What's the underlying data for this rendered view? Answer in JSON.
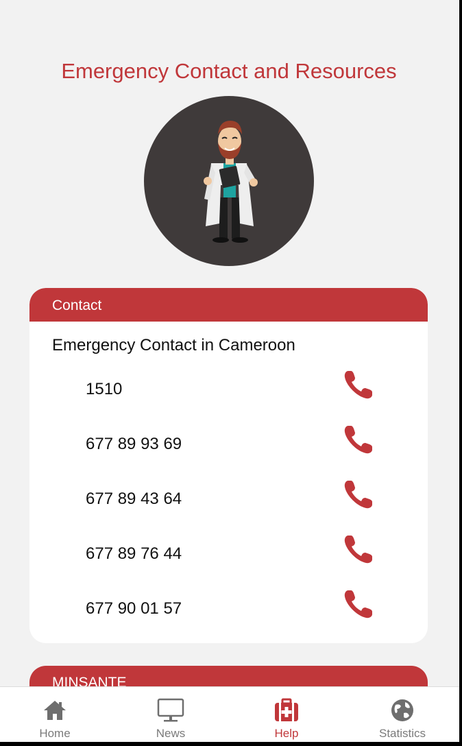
{
  "page": {
    "title": "Emergency Contact and Resources"
  },
  "contact_card": {
    "header": "Contact",
    "subtitle": "Emergency Contact in Cameroon",
    "numbers": [
      "1510",
      "677 89 93 69",
      "677 89 43 64",
      "677 89 76 44",
      "677 90 01 57"
    ],
    "call_icon": "phone-icon"
  },
  "second_card": {
    "header": "MINSANTE"
  },
  "bottom_nav": {
    "items": [
      {
        "label": "Home",
        "icon": "home-icon"
      },
      {
        "label": "News",
        "icon": "monitor-icon"
      },
      {
        "label": "Help",
        "icon": "first-aid-kit-icon"
      },
      {
        "label": "Statistics",
        "icon": "globe-icon"
      }
    ],
    "active": "Help"
  },
  "colors": {
    "accent": "#c0373a",
    "background": "#f2f2f2",
    "avatar_bg": "#3f3a3a",
    "nav_inactive": "#7a7a7a"
  }
}
